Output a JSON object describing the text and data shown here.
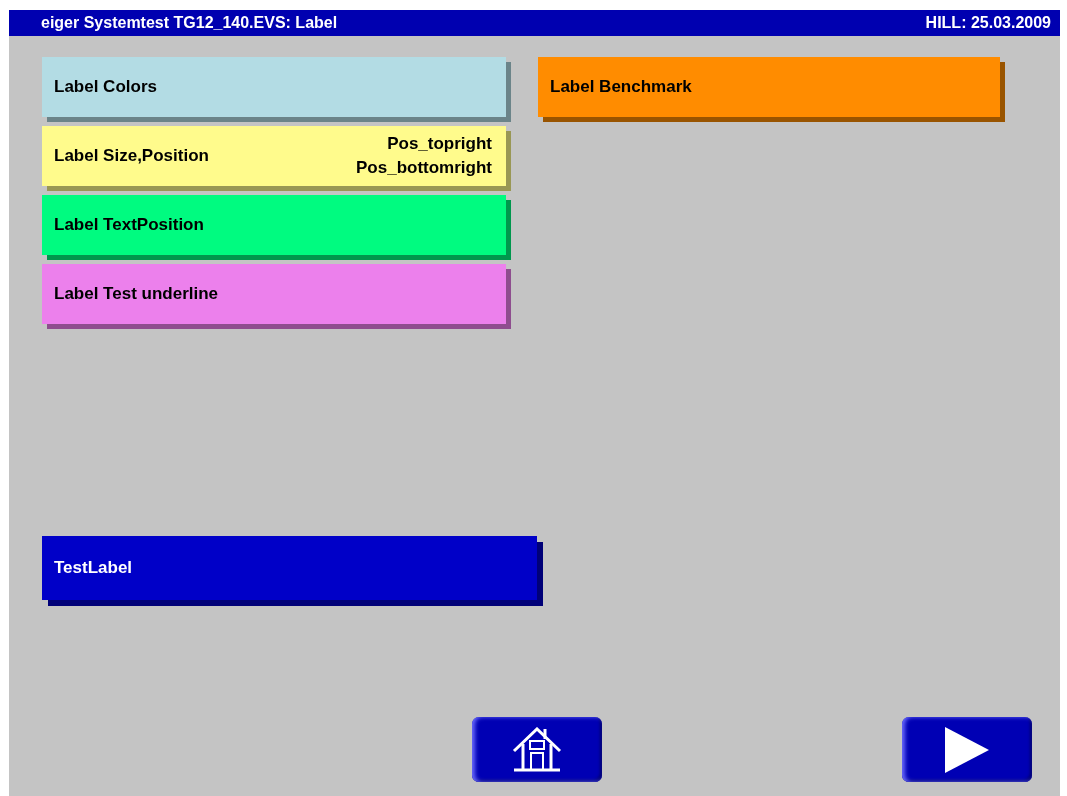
{
  "title_bar": {
    "title": "eiger Systemtest TG12_140.EVS: Label",
    "info": "HILL: 25.03.2009"
  },
  "left_labels": [
    {
      "text": "Label Colors",
      "color": "#b3dce4"
    },
    {
      "text": "Label Size,Position",
      "color": "#fffb8c",
      "corner_texts": [
        "Pos_topright",
        "Pos_bottomright"
      ]
    },
    {
      "text": "Label TextPosition",
      "color": "#00fb80"
    },
    {
      "text": "Label Test underline",
      "color": "#ec80ec"
    }
  ],
  "right_labels": [
    {
      "text": "Label Benchmark",
      "color": "#ff8c00"
    }
  ],
  "test_label": {
    "text": "TestLabel",
    "color": "#0000c8"
  },
  "nav_buttons": [
    {
      "kind": "home"
    },
    {
      "kind": "next"
    }
  ]
}
